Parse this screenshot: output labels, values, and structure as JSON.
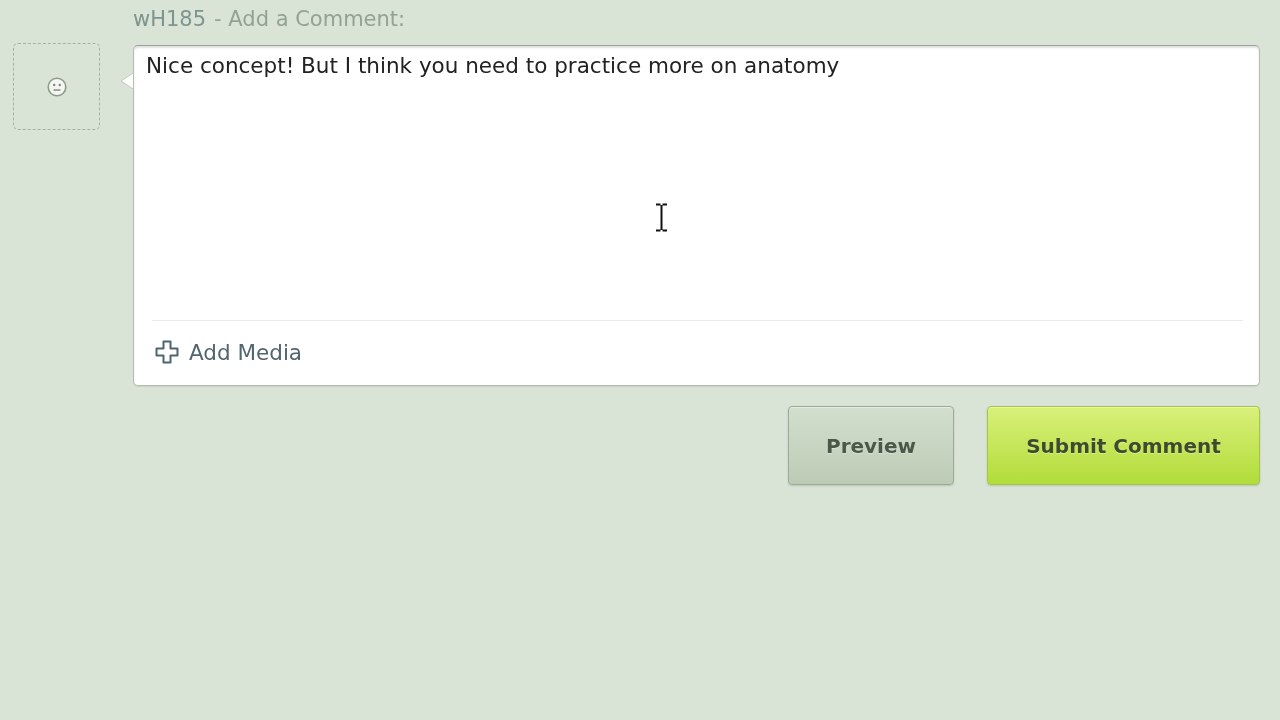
{
  "heading": {
    "username": "wH185",
    "text": "- Add a Comment:"
  },
  "comment": {
    "value": "Nice concept! But I think you need to practice more on anatomy"
  },
  "add_media": {
    "label": "Add Media"
  },
  "buttons": [
    {
      "label": "Preview",
      "kind": "secondary"
    },
    {
      "label": "Submit Comment",
      "kind": "primary"
    }
  ]
}
